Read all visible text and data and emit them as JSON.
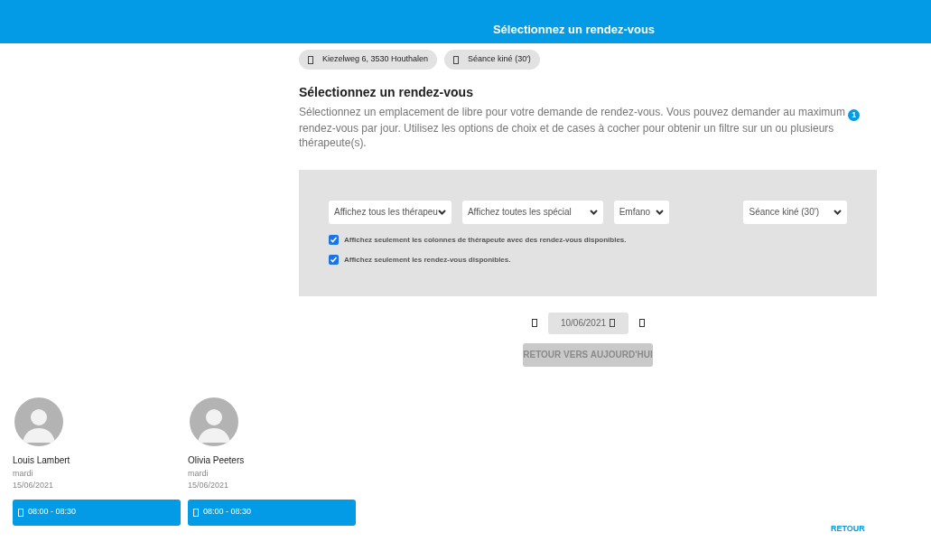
{
  "header": {
    "title": "Sélectionnez un rendez-vous"
  },
  "chips": [
    {
      "label": "Kiezelweg 6, 3530 Houthalen"
    },
    {
      "label": "Séance kiné (30')"
    }
  ],
  "section": {
    "title": "Sélectionnez un rendez-vous",
    "text_before": "Sélectionnez un emplacement de libre pour votre demande de rendez-vous. Vous pouvez demander au maximum",
    "badge": "1",
    "text_after": "rendez-vous par jour. Utilisez les options de choix et de cases à cocher pour obtenir un filtre sur un ou plusieurs thérapeute(s)."
  },
  "filters": {
    "dropdowns": [
      {
        "value": "Affichez tous les thérapeu"
      },
      {
        "value": "Affichez toutes les spécial"
      },
      {
        "value": "Emfano"
      },
      {
        "value": "Séance kiné (30')"
      }
    ],
    "checkboxes": [
      {
        "label": "Affichez seulement les colonnes de thérapeute avec des rendez-vous disponibles.",
        "checked": true
      },
      {
        "label": "Affichez seulement les rendez-vous disponibles.",
        "checked": true
      }
    ]
  },
  "date_nav": {
    "date": "10/06/2021",
    "today_button": "RETOUR VERS AUJOURD'HUI"
  },
  "therapists": [
    {
      "name": "Louis Lambert",
      "day": "mardi",
      "date": "15/06/2021",
      "slots": [
        "08:00 - 08:30"
      ]
    },
    {
      "name": "Olivia Peeters",
      "day": "mardi",
      "date": "15/06/2021",
      "slots": [
        "08:00 - 08:30"
      ]
    }
  ],
  "back_link": "RETOUR"
}
